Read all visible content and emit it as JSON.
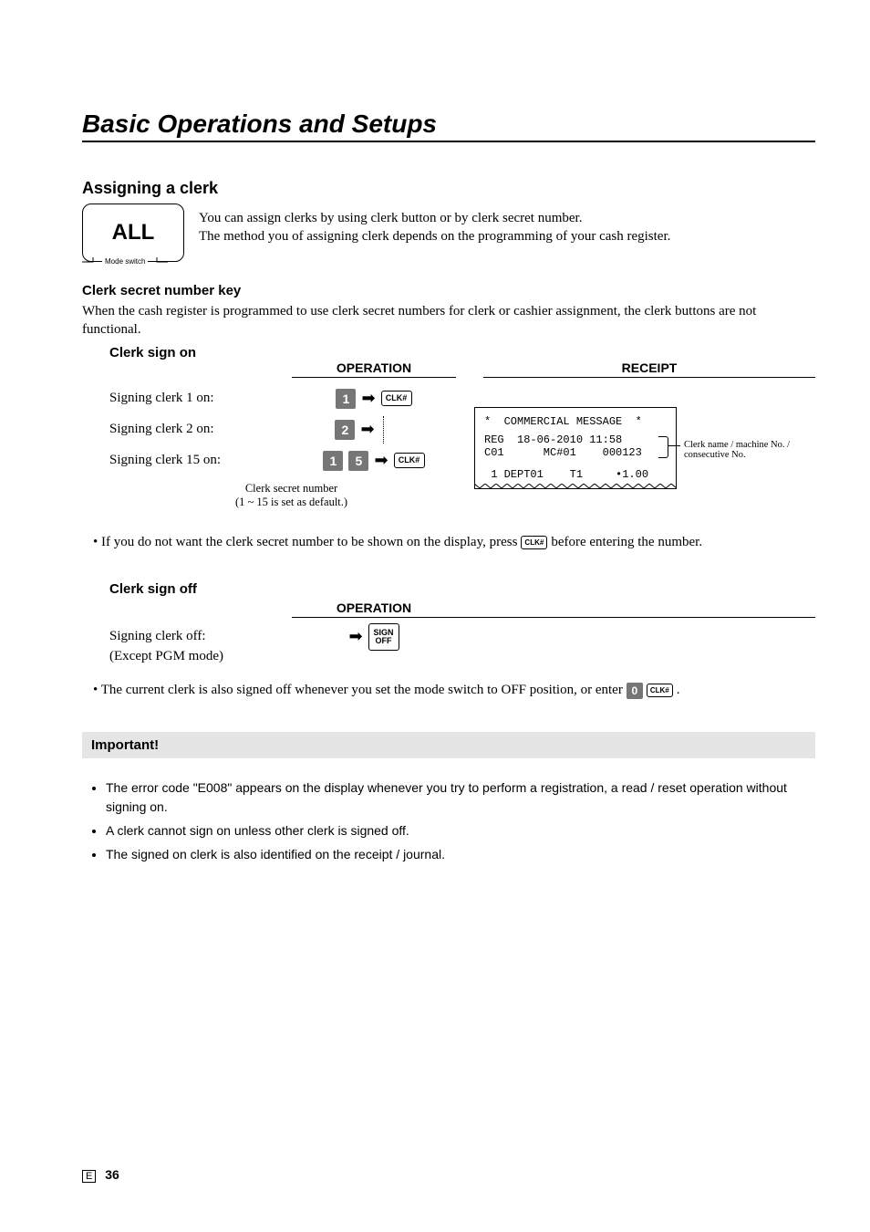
{
  "title": "Basic Operations and Setups",
  "assign_heading": "Assigning a clerk",
  "mode_box": "ALL",
  "mode_switch_label": "Mode switch",
  "intro_line1": "You can assign clerks by using clerk button or by clerk secret number.",
  "intro_line2": "The method you of assigning clerk depends on the programming of your cash register.",
  "csn_heading": "Clerk secret number key",
  "csn_text": "When the cash register is programmed to use clerk secret numbers for clerk or cashier assignment, the clerk buttons are not functional.",
  "sign_on_heading": "Clerk sign on",
  "col_operation": "OPERATION",
  "col_receipt": "RECEIPT",
  "signing1": "Signing clerk 1 on:",
  "signing2": "Signing clerk 2 on:",
  "signing15": "Signing clerk 15 on:",
  "key_1": "1",
  "key_2": "2",
  "key_5": "5",
  "key_0": "0",
  "key_clk": "CLK#",
  "key_signoff_l1": "SIGN",
  "key_signoff_l2": "OFF",
  "secret_note_l1": "Clerk secret number",
  "secret_note_l2": "(1 ~ 15 is set as default.)",
  "receipt_l1": "*  COMMERCIAL MESSAGE  *",
  "receipt_l2": "REG  18-06-2010 11:58",
  "receipt_l3": "C01      MC#01    000123",
  "receipt_l4": " 1 DEPT01    T1     •1.00",
  "receipt_annot": "Clerk name / machine No. / consecutive No.",
  "note1_pre": "• If you do not want the clerk secret number to be shown on the display, press ",
  "note1_post": " before entering the number.",
  "sign_off_heading": "Clerk sign off",
  "signing_off": "Signing clerk off:",
  "signing_off_sub": "(Except PGM mode)",
  "note2_pre": "• The current clerk is also signed off whenever you set the mode switch to OFF position, or enter ",
  "note2_post": ".",
  "important_heading": "Important!",
  "important_items": [
    "The error code \"E008\" appears on the display whenever you try to perform a registration, a read / reset operation without signing on.",
    "A clerk cannot sign on unless other clerk is signed off.",
    "The signed on clerk is also identified on the receipt / journal."
  ],
  "page_letter": "E",
  "page_number": "36"
}
